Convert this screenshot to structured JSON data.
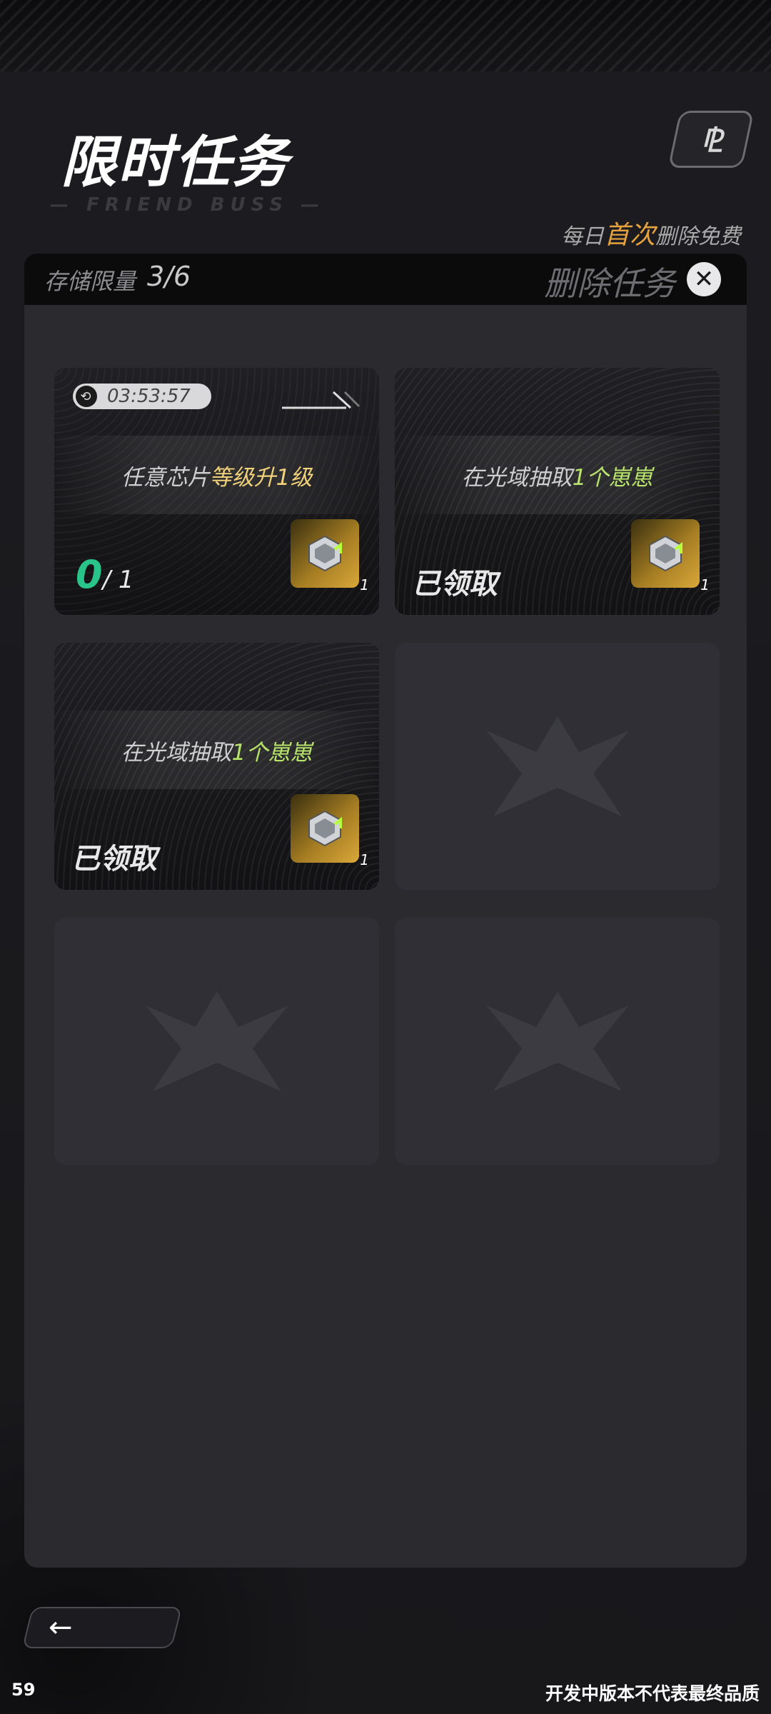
{
  "header": {
    "title": "限时任务",
    "subtitle": "— FRIEND BUSS —",
    "logo_glyph": "⅊"
  },
  "daily_note": {
    "prefix": "每日",
    "highlight": "首次",
    "suffix": "删除免费",
    "highlight_color": "#e6a23c"
  },
  "storage": {
    "label": "存储限量",
    "value": "3/6"
  },
  "delete_button": {
    "label": "删除任务",
    "close_glyph": "✕"
  },
  "cards": [
    {
      "timer": "03:53:57",
      "timer_icon": "clock-icon",
      "task_prefix": "任意芯片",
      "task_highlight": "等级升1级",
      "progress_current": "0",
      "progress_total": "/ 1",
      "reward_icon": "gem-icon",
      "reward_count": "1"
    },
    {
      "task_prefix": "在光域抽取",
      "task_highlight": "1个崽崽",
      "status": "已领取",
      "reward_icon": "gem-icon",
      "reward_count": "1"
    },
    {
      "task_prefix": "在光域抽取",
      "task_highlight": "1个崽崽",
      "status": "已领取",
      "reward_icon": "gem-icon",
      "reward_count": "1"
    }
  ],
  "empty_slots": 3,
  "footer": {
    "back_glyph": "←",
    "fps": "59",
    "disclaimer": "开发中版本不代表最终品质"
  }
}
